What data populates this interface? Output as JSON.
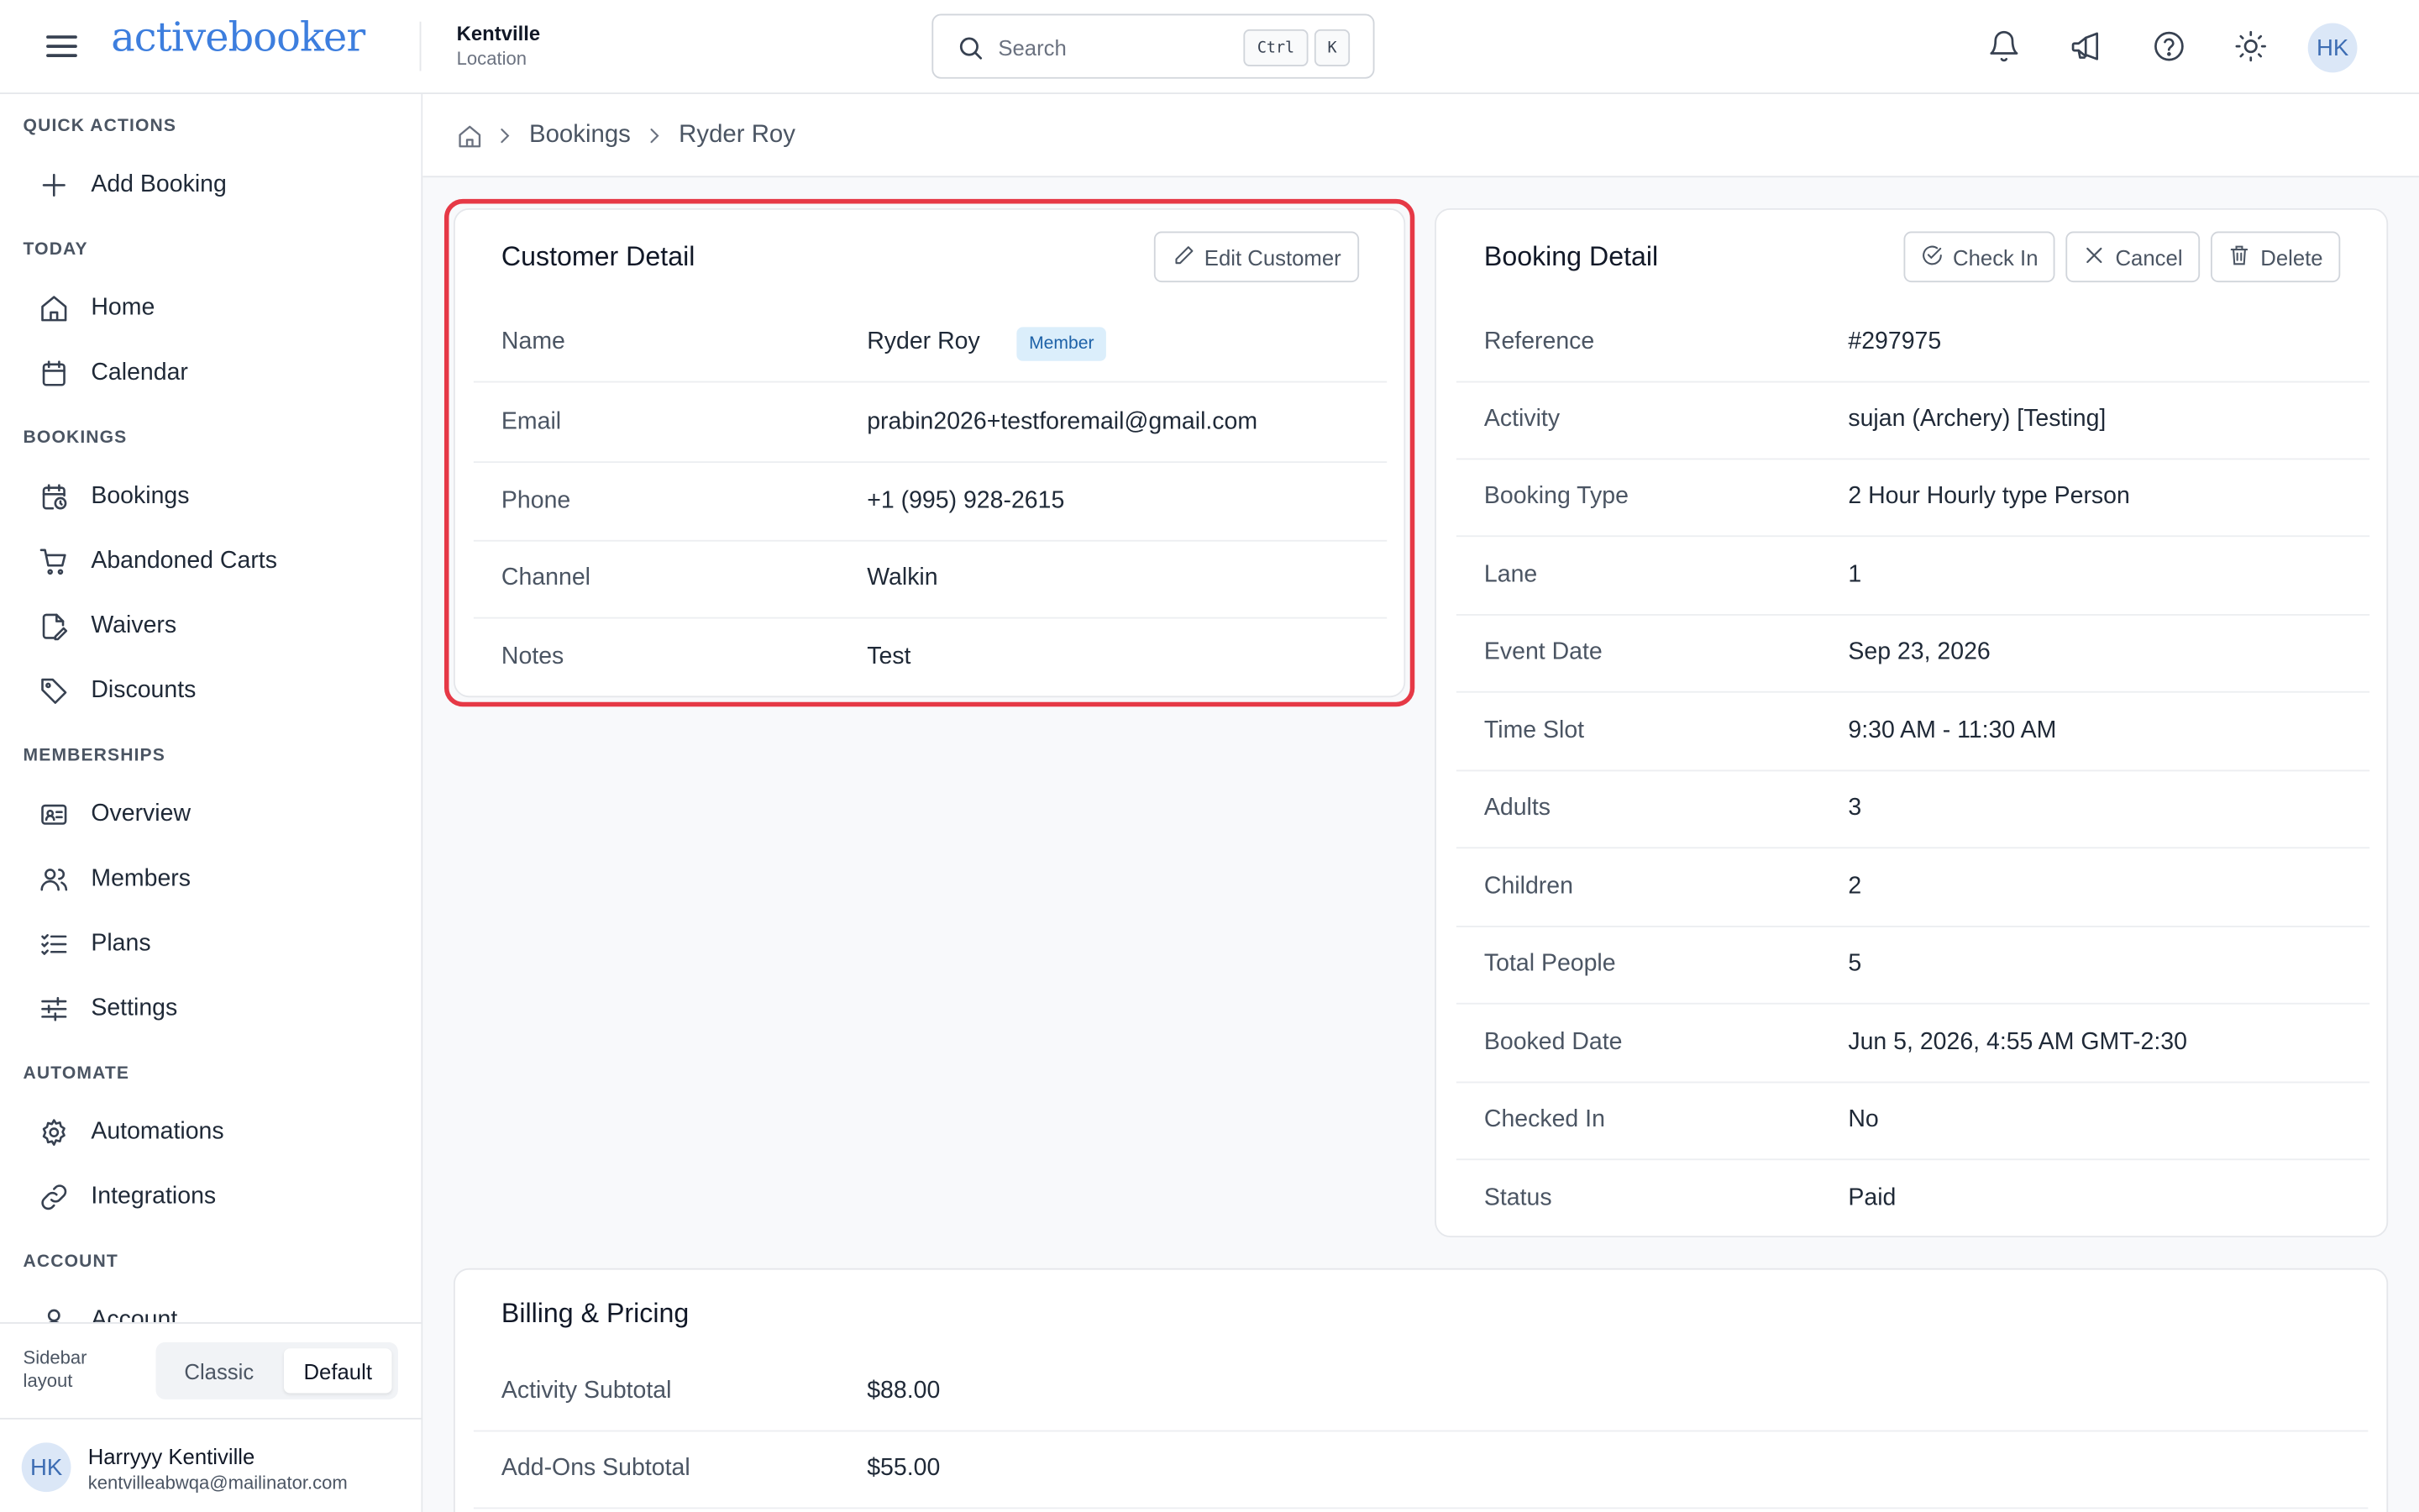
{
  "brand": {
    "logo_text": "activebooker",
    "accent": "#3d7ede"
  },
  "location": {
    "name": "Kentville",
    "label": "Location"
  },
  "search": {
    "placeholder": "Search",
    "kbd_ctrl": "Ctrl",
    "kbd_k": "K"
  },
  "top_icons": [
    "bell-icon",
    "megaphone-icon",
    "help-icon",
    "sun-icon"
  ],
  "user": {
    "initials": "HK",
    "name": "Harryyy Kentiville",
    "email": "kentvilleabwqa@mailinator.com"
  },
  "sidebar": {
    "sections": [
      {
        "title": "QUICK ACTIONS",
        "items": [
          {
            "label": "Add Booking",
            "icon": "plus-icon"
          }
        ]
      },
      {
        "title": "TODAY",
        "items": [
          {
            "label": "Home",
            "icon": "home-icon"
          },
          {
            "label": "Calendar",
            "icon": "calendar-icon"
          }
        ]
      },
      {
        "title": "BOOKINGS",
        "items": [
          {
            "label": "Bookings",
            "icon": "calendar-clock-icon"
          },
          {
            "label": "Abandoned Carts",
            "icon": "cart-icon"
          },
          {
            "label": "Waivers",
            "icon": "file-pen-icon"
          },
          {
            "label": "Discounts",
            "icon": "tag-icon"
          }
        ]
      },
      {
        "title": "MEMBERSHIPS",
        "items": [
          {
            "label": "Overview",
            "icon": "id-card-icon"
          },
          {
            "label": "Members",
            "icon": "users-icon"
          },
          {
            "label": "Plans",
            "icon": "list-checks-icon"
          },
          {
            "label": "Settings",
            "icon": "sliders-icon"
          }
        ]
      },
      {
        "title": "AUTOMATE",
        "items": [
          {
            "label": "Automations",
            "icon": "gear-icon"
          },
          {
            "label": "Integrations",
            "icon": "link-icon"
          }
        ]
      },
      {
        "title": "ACCOUNT",
        "items": [
          {
            "label": "Account",
            "icon": "user-icon"
          }
        ]
      }
    ],
    "layout_label": "Sidebar layout",
    "layout_options": {
      "classic": "Classic",
      "default": "Default"
    },
    "layout_selected": "Default"
  },
  "breadcrumb": {
    "items": [
      "Bookings",
      "Ryder Roy"
    ]
  },
  "customer": {
    "title": "Customer Detail",
    "edit_label": "Edit Customer",
    "badge": "Member",
    "rows": [
      {
        "key": "Name",
        "value": "Ryder Roy"
      },
      {
        "key": "Email",
        "value": "prabin2026+testforemail@gmail.com"
      },
      {
        "key": "Phone",
        "value": "+1 (995) 928-2615"
      },
      {
        "key": "Channel",
        "value": "Walkin"
      },
      {
        "key": "Notes",
        "value": "Test"
      }
    ]
  },
  "booking": {
    "title": "Booking Detail",
    "checkin_label": "Check In",
    "cancel_label": "Cancel",
    "delete_label": "Delete",
    "rows": [
      {
        "key": "Reference",
        "value": "#297975"
      },
      {
        "key": "Activity",
        "value": "sujan (Archery) [Testing]"
      },
      {
        "key": "Booking Type",
        "value": "2 Hour Hourly type Person"
      },
      {
        "key": "Lane",
        "value": "1"
      },
      {
        "key": "Event Date",
        "value": "Sep 23, 2026"
      },
      {
        "key": "Time Slot",
        "value": "9:30 AM - 11:30 AM"
      },
      {
        "key": "Adults",
        "value": "3"
      },
      {
        "key": "Children",
        "value": "2"
      },
      {
        "key": "Total People",
        "value": "5"
      },
      {
        "key": "Booked Date",
        "value": "Jun 5, 2026, 4:55 AM GMT-2:30"
      },
      {
        "key": "Checked In",
        "value": "No"
      },
      {
        "key": "Status",
        "value": "Paid"
      }
    ]
  },
  "billing": {
    "title": "Billing & Pricing",
    "rows": [
      {
        "key": "Activity Subtotal",
        "value": "$88.00"
      },
      {
        "key": "Add-Ons Subtotal",
        "value": "$55.00"
      }
    ]
  },
  "highlight_color": "#e63946"
}
